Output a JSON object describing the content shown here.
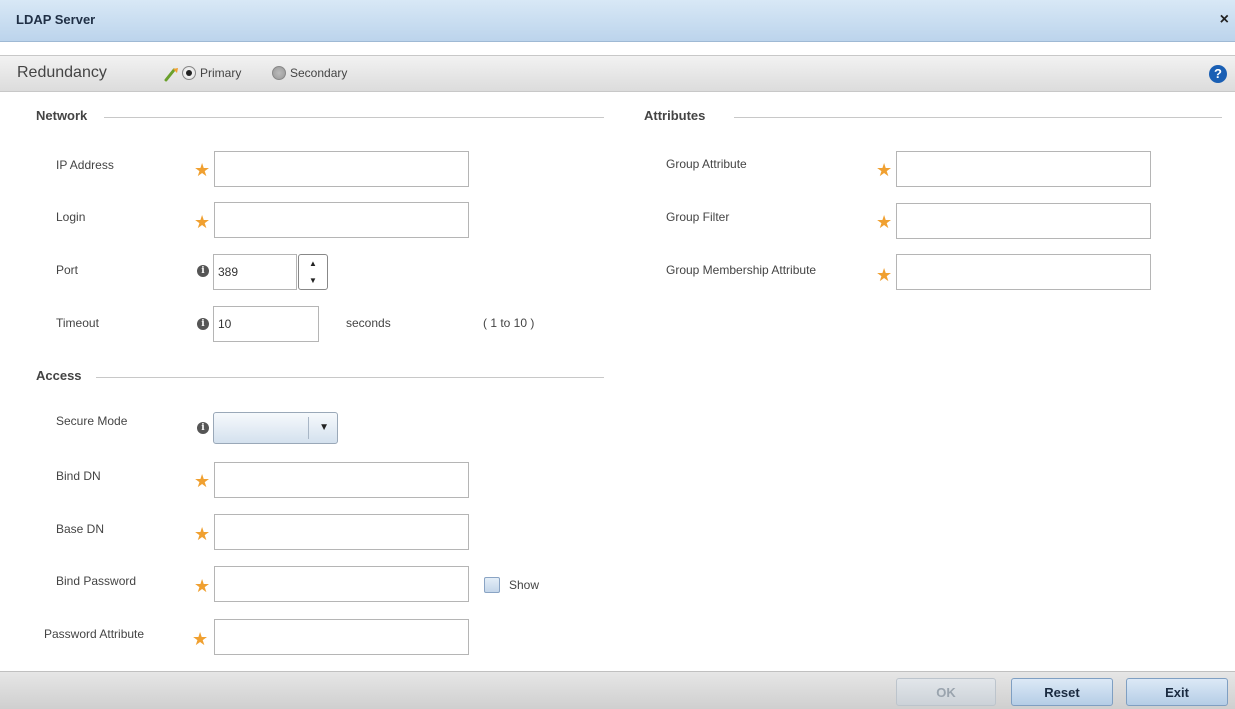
{
  "window": {
    "title": "LDAP Server",
    "close_icon": "×"
  },
  "redundancy": {
    "label": "Redundancy",
    "options": [
      {
        "label": "Primary",
        "selected": true
      },
      {
        "label": "Secondary",
        "selected": false
      }
    ],
    "help_icon": "?"
  },
  "network": {
    "title": "Network",
    "ip_address": {
      "label": "IP Address",
      "value": ""
    },
    "login": {
      "label": "Login",
      "value": ""
    },
    "port": {
      "label": "Port",
      "value": "389"
    },
    "timeout": {
      "label": "Timeout",
      "value": "10",
      "unit": "seconds",
      "range": "( 1 to 10 )"
    }
  },
  "access": {
    "title": "Access",
    "secure_mode": {
      "label": "Secure Mode",
      "value": ""
    },
    "bind_dn": {
      "label": "Bind DN",
      "value": ""
    },
    "base_dn": {
      "label": "Base DN",
      "value": ""
    },
    "bind_password": {
      "label": "Bind Password",
      "value": "",
      "show_label": "Show"
    },
    "password_attribute": {
      "label": "Password Attribute",
      "value": ""
    }
  },
  "attributes": {
    "title": "Attributes",
    "group_attribute": {
      "label": "Group Attribute",
      "value": ""
    },
    "group_filter": {
      "label": "Group Filter",
      "value": ""
    },
    "group_membership_attribute": {
      "label": "Group Membership Attribute",
      "value": ""
    }
  },
  "footer": {
    "ok_label": "OK",
    "reset_label": "Reset",
    "exit_label": "Exit"
  },
  "colors": {
    "required_star": "#f0a030",
    "help_blue": "#1a5fb4",
    "titlebar": "#c8dcef"
  }
}
